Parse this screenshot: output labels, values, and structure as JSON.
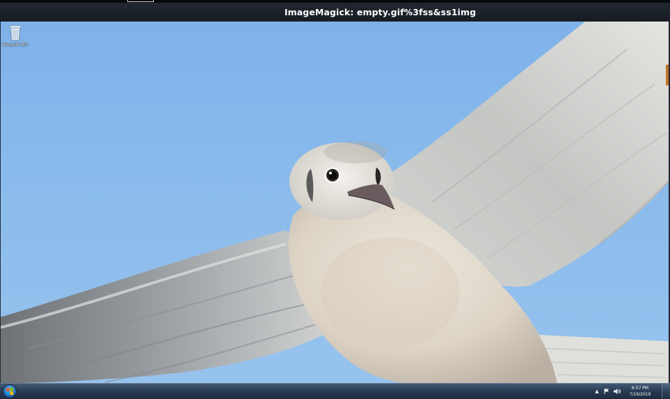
{
  "window": {
    "title": "ImageMagick: empty.gif%3fss&ss1img"
  },
  "desktop": {
    "icons": [
      {
        "label": "Recycle Bin",
        "icon": "recycle-bin-icon"
      }
    ]
  },
  "taskbar": {
    "start_icon": "windows-start-orb",
    "tray": {
      "icons": [
        "show-hidden-icons-chevron",
        "action-center-flag-icon",
        "volume-icon"
      ],
      "time": "6:57 PM",
      "date": "7/19/2019"
    }
  },
  "colors": {
    "titlebar": "#1b2027",
    "sky": "#8abbec",
    "taskbar": "#2c4260"
  }
}
